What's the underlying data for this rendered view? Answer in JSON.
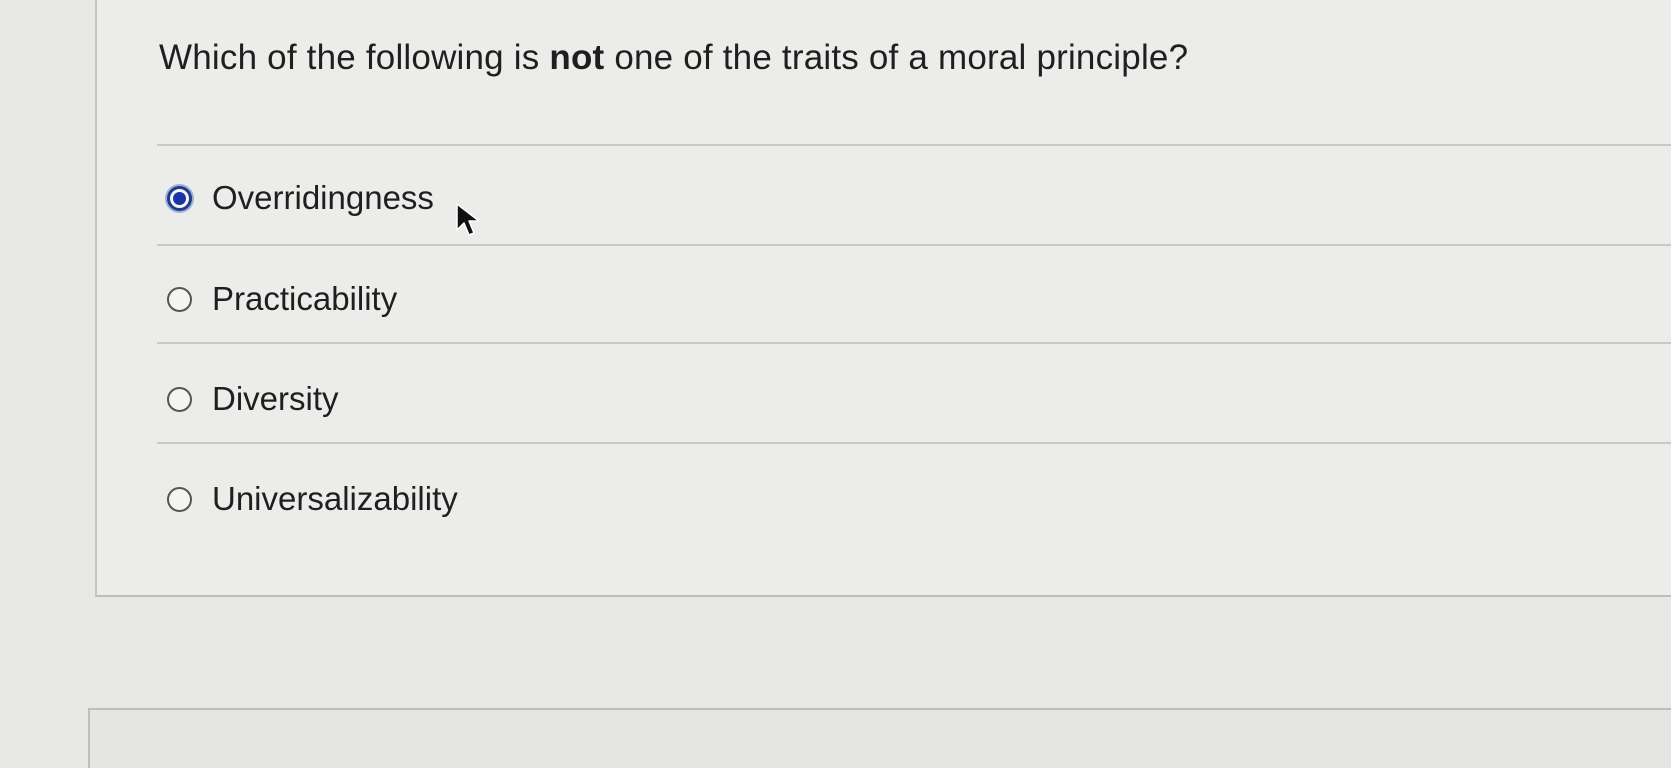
{
  "question": {
    "text_before": "Which of the following is ",
    "text_emphasis": "not",
    "text_after": " one of the traits of a moral principle?"
  },
  "options": [
    {
      "label": "Overridingness",
      "selected": true
    },
    {
      "label": "Practicability",
      "selected": false
    },
    {
      "label": "Diversity",
      "selected": false
    },
    {
      "label": "Universalizability",
      "selected": false
    }
  ],
  "colors": {
    "selected_radio": "#1a33a8",
    "background": "#e7e7e5"
  },
  "icons": {
    "cursor": "mouse-pointer-icon"
  }
}
